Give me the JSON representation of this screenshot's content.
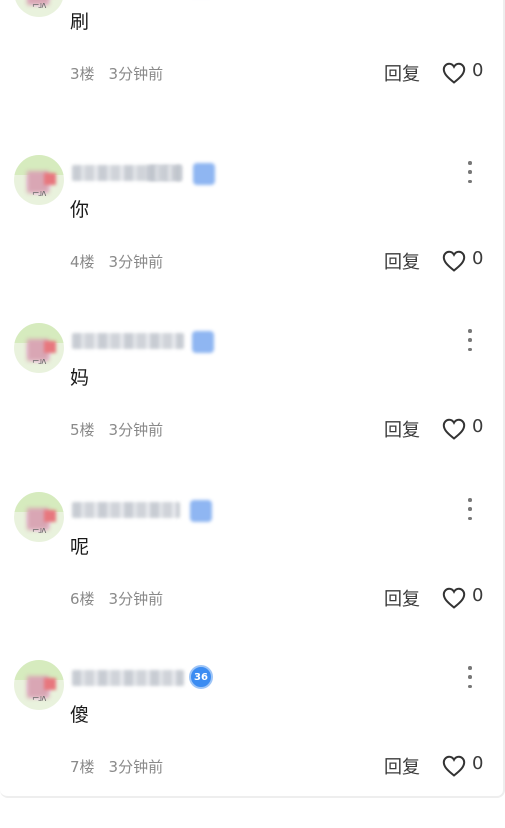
{
  "comments": [
    {
      "content": "刷",
      "floor": "3楼",
      "time": "3分钟前",
      "reply_label": "回复",
      "like_count": "0",
      "level_badge": ""
    },
    {
      "content": "你",
      "floor": "4楼",
      "time": "3分钟前",
      "reply_label": "回复",
      "like_count": "0",
      "level_badge": ""
    },
    {
      "content": "妈",
      "floor": "5楼",
      "time": "3分钟前",
      "reply_label": "回复",
      "like_count": "0",
      "level_badge": ""
    },
    {
      "content": "呢",
      "floor": "6楼",
      "time": "3分钟前",
      "reply_label": "回复",
      "like_count": "0",
      "level_badge": ""
    },
    {
      "content": "傻",
      "floor": "7楼",
      "time": "3分钟前",
      "reply_label": "回复",
      "like_count": "0",
      "level_badge": "36"
    }
  ],
  "icons": {
    "more": "more-vertical-icon",
    "like": "heart-outline-icon",
    "badge": "level-badge-icon"
  },
  "colors": {
    "badge_blue": "#3b8cf2",
    "meta_gray": "#8a8a8a",
    "text": "#1a1a1a"
  }
}
